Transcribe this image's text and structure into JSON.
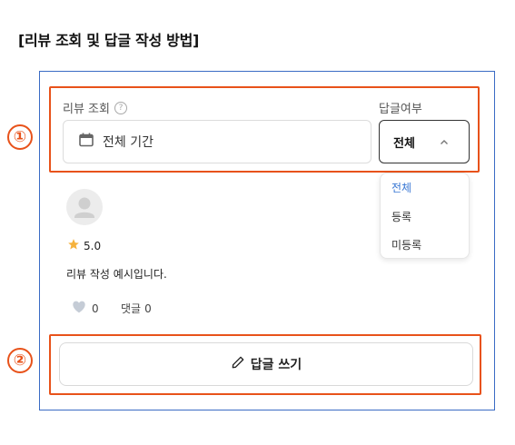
{
  "page": {
    "heading": "[리뷰 조회 및 답글 작성 방법]"
  },
  "markers": [
    "①",
    "②"
  ],
  "filter": {
    "review_label": "리뷰 조회",
    "help_glyph": "?",
    "date_value": "전체 기간",
    "reply_label": "답글여부",
    "reply_selected": "전체",
    "reply_options": [
      "전체",
      "등록",
      "미등록"
    ]
  },
  "review": {
    "rating": "5.0",
    "text": "리뷰 작성 예시입니다.",
    "like_count": "0",
    "comment_label": "댓글",
    "comment_count": "0"
  },
  "write_button": {
    "label": "답글 쓰기"
  },
  "colors": {
    "highlight": "#e8521a",
    "frame": "#3a6bc4",
    "active_option": "#3a78d4",
    "star": "#f5b23d"
  },
  "icons": [
    "help-icon",
    "calendar-icon",
    "chevron-up-icon",
    "user-avatar-icon",
    "star-icon",
    "heart-icon",
    "pencil-icon"
  ]
}
